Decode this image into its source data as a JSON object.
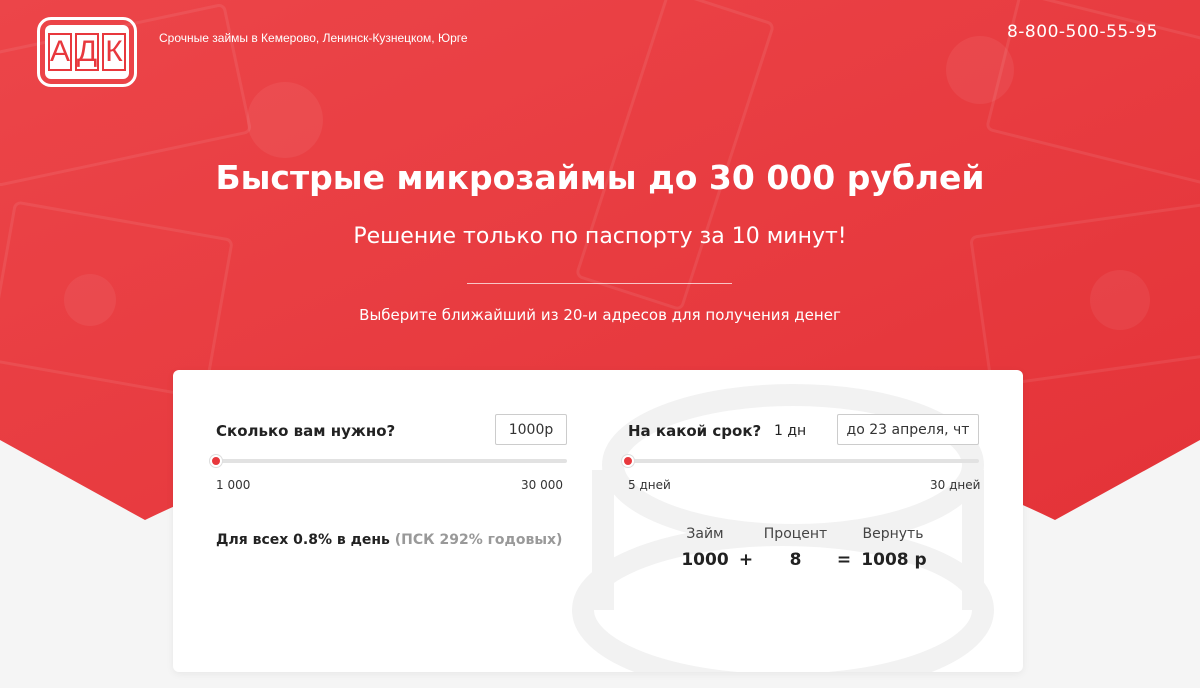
{
  "header": {
    "logo_letters": [
      "А",
      "Д",
      "К"
    ],
    "tagline": "Срочные займы в Кемерово, Ленинск-Кузнецком, Юрге",
    "phone": "8-800-500-55-95"
  },
  "hero": {
    "title": "Быстрые микрозаймы до 30 000 рублей",
    "subtitle": "Решение только по паспорту за 10 минут!",
    "choose_text": "Выберите ближайший из 20-и адресов для получения денег"
  },
  "calculator": {
    "amount": {
      "label": "Сколько вам нужно?",
      "value": "1000р",
      "min_label": "1 000",
      "max_label": "30 000",
      "fraction": 0.0
    },
    "term": {
      "label": "На какой срок?",
      "value": "1 дн",
      "date": "до 23 апреля, чт",
      "min_label": "5 дней",
      "max_label": "30 дней",
      "fraction": 0.0
    },
    "rate": {
      "main": "Для всех 0.8% в день",
      "note": "(ПСК 292% годовых)"
    },
    "summary": {
      "loan_label": "Займ",
      "interest_label": "Процент",
      "return_label": "Вернуть",
      "loan_value": "1000",
      "plus": "+",
      "interest_value": "8",
      "equals": "=",
      "return_value": "1008 р"
    }
  },
  "colors": {
    "brand_red": "#e8383d",
    "background": "#f5f5f5"
  }
}
